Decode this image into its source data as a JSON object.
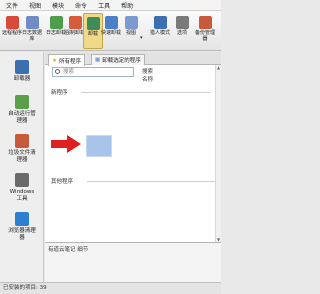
{
  "menu": [
    "文件",
    "视图",
    "模块",
    "命令",
    "工具",
    "帮助"
  ],
  "toolbar": {
    "buttons": [
      {
        "label": "远程程序",
        "icon": "remote-icon",
        "color": "#d84a3a"
      },
      {
        "label": "日志数据库",
        "icon": "database-icon",
        "color": "#6f8cc7"
      },
      {
        "label": "日志卸载",
        "icon": "log-uninstall-icon",
        "color": "#4f9c4a"
      },
      {
        "label": "强制卸载",
        "icon": "force-uninstall-icon",
        "color": "#d65c3c"
      },
      {
        "label": "卸载",
        "icon": "uninstall-icon",
        "color": "#3d8c5a"
      },
      {
        "label": "快速卸载",
        "icon": "quick-uninstall-icon",
        "color": "#4d7fc7"
      },
      {
        "label": "视图",
        "icon": "view-icon",
        "color": "#7b9ad0"
      },
      {
        "label": "猎人模式",
        "icon": "hunter-icon",
        "color": "#3a6fb0"
      },
      {
        "label": "选项",
        "icon": "options-icon",
        "color": "#7a7a7a"
      },
      {
        "label": "备份管理器",
        "icon": "backup-icon",
        "color": "#c75a3a"
      }
    ]
  },
  "nav": [
    {
      "label": "卸载器",
      "icon": "uninstaller-icon",
      "color": "#3a6fb0"
    },
    {
      "label": "自动运行管理器",
      "icon": "autorun-icon",
      "color": "#5aa04a"
    },
    {
      "label": "垃圾文件清理器",
      "icon": "junk-cleaner-icon",
      "color": "#c75a3a"
    },
    {
      "label": "Windows 工具",
      "icon": "windows-tools-icon",
      "color": "#6a6a6a"
    },
    {
      "label": "浏览器清理器",
      "icon": "browser-cleaner-icon",
      "color": "#2f7fd0"
    }
  ],
  "tabs": [
    {
      "label": "所有程序",
      "icon": "star-icon"
    },
    {
      "label": "卸载选定的程序",
      "icon": "grid-icon"
    }
  ],
  "search": {
    "placeholder": "搜索"
  },
  "columns": {
    "search": "搜索",
    "name": "名称"
  },
  "sections": {
    "new_programs": "新程序",
    "other_programs": "其他程序"
  },
  "panel": {
    "title": "有道云笔记 细节"
  },
  "status": "已安装的项目: 39"
}
